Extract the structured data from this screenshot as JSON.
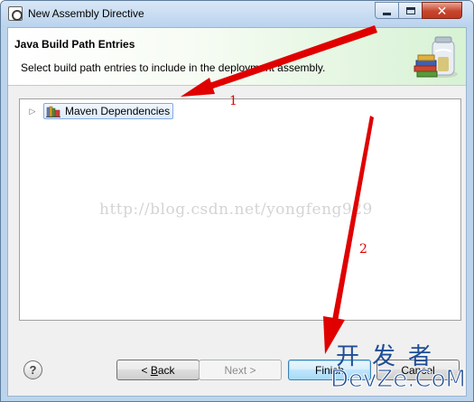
{
  "window": {
    "title": "New Assembly Directive"
  },
  "header": {
    "title": "Java Build Path Entries",
    "description": "Select build path entries to include in the deployment assembly."
  },
  "tree": {
    "items": [
      {
        "label": "Maven Dependencies",
        "expanded": false,
        "selected": true,
        "icon": "library-icon"
      }
    ]
  },
  "buttons": {
    "help": "?",
    "back_prefix": "< ",
    "back_mnemonic": "B",
    "back_rest": "ack",
    "next": "Next >",
    "finish": "Finish",
    "cancel": "Cancel"
  },
  "annotations": {
    "watermark": "http://blog.csdn.net/yongfeng929",
    "label_1": "1",
    "label_2": "2",
    "arrow_color": "#e00000"
  },
  "brand": {
    "line1": "开发者",
    "line2": "DevZe.CoM"
  },
  "colors": {
    "header_gradient_end": "#d7f2d4",
    "close_button": "#c7452e",
    "title_bar": "#bad3ee"
  }
}
